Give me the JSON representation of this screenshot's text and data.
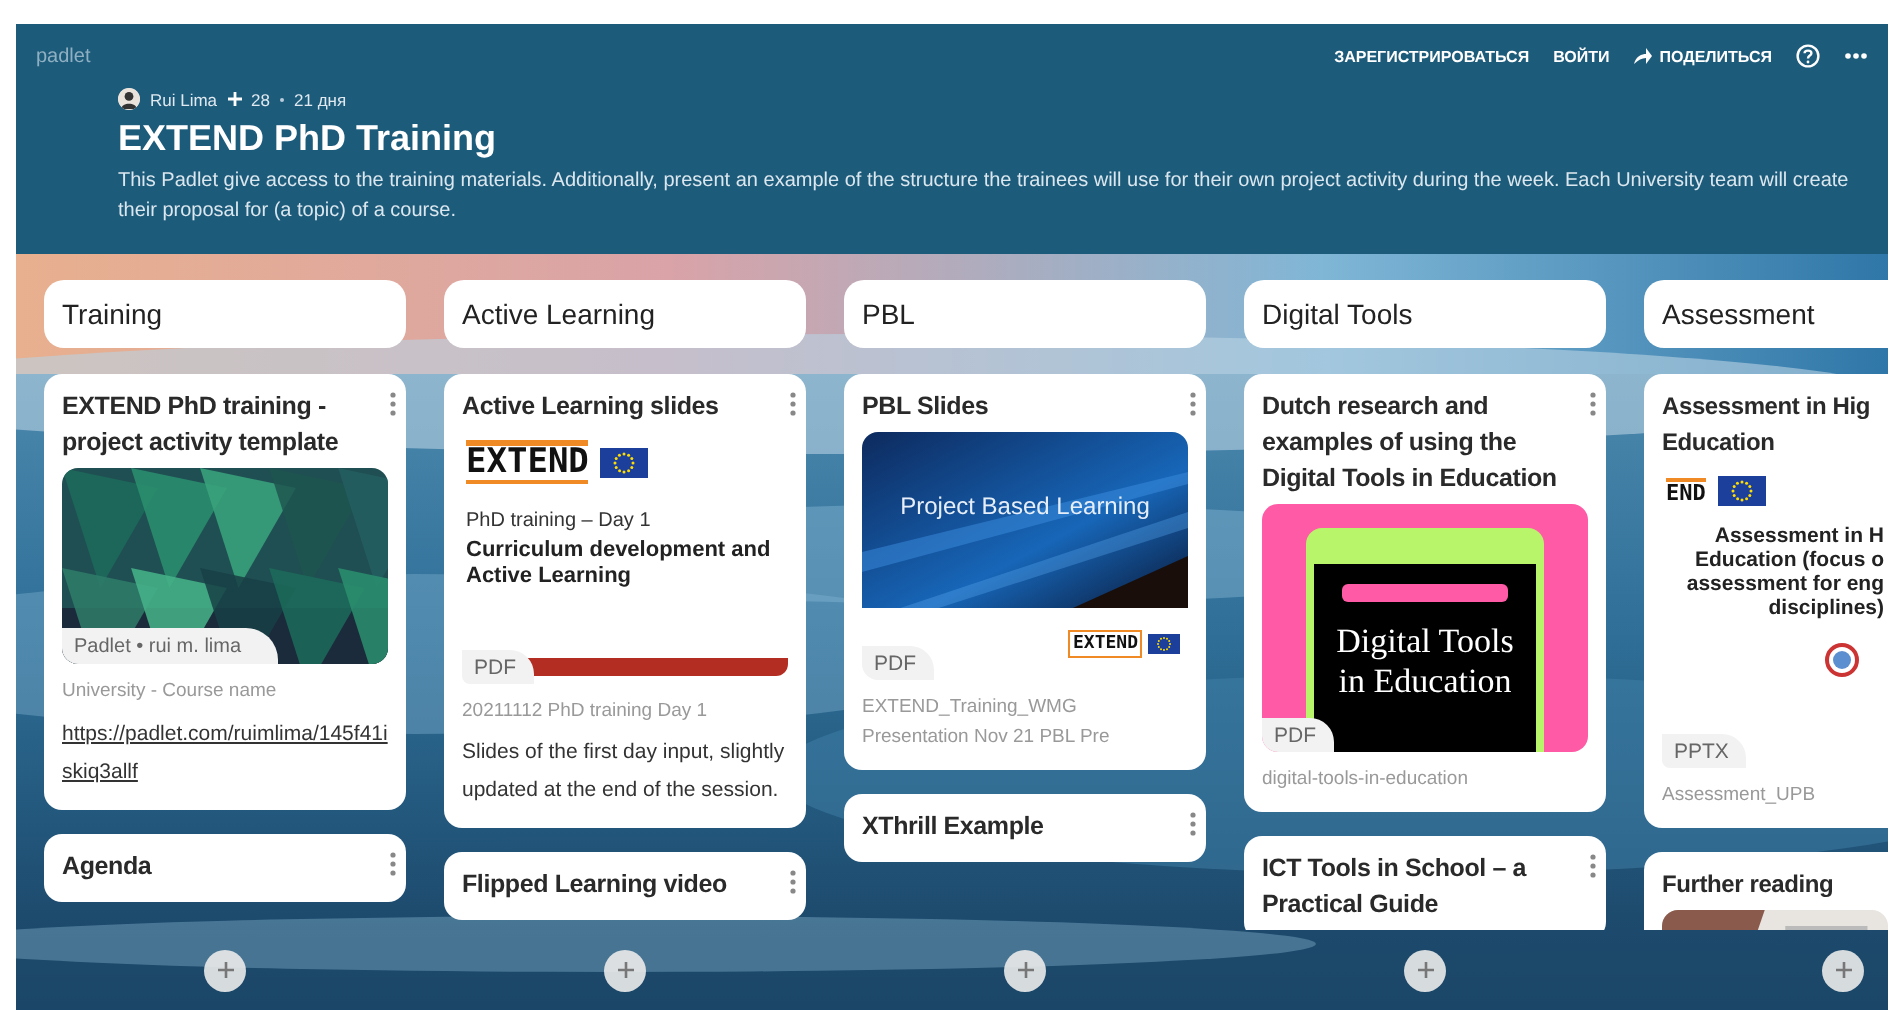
{
  "header": {
    "logo": "padlet",
    "actions": [
      {
        "kind": "text",
        "label": "ЗАРЕГИСТРИРОВАТЬСЯ"
      },
      {
        "kind": "text",
        "label": "ВОЙТИ"
      },
      {
        "kind": "share",
        "label": "ПОДЕЛИТЬСЯ"
      },
      {
        "kind": "help"
      },
      {
        "kind": "more"
      }
    ],
    "author": "Rui Lima",
    "likes": "28",
    "age": "21 дня",
    "title": "EXTEND PhD Training",
    "description": "This Padlet give access to the training materials. Additionally, present an example of the structure the trainees will use for their own project activity during the week. Each University team will create their proposal for (a topic) of a course."
  },
  "columns": [
    {
      "title": "Training",
      "posts": [
        {
          "title": "EXTEND PhD training - project activity template",
          "attachment": {
            "kind": "picture",
            "source": "Padlet • rui m. lima"
          },
          "caption": "University - Course name",
          "link": "https://padlet.com/ruimlima/145f41iskiq3allf"
        },
        {
          "title": "Agenda"
        }
      ]
    },
    {
      "title": "Active Learning",
      "posts": [
        {
          "title": "Active Learning slides",
          "attachment": {
            "kind": "document",
            "badge": "PDF",
            "logo": "EXTEND",
            "subtitle": "PhD training – Day 1",
            "heading": "Curriculum development and Active Learning"
          },
          "caption": "20211112 PhD training Day 1",
          "body": "Slides of the first day input, slightly updated at the end of the session."
        },
        {
          "title": "Flipped Learning video"
        }
      ]
    },
    {
      "title": "PBL",
      "posts": [
        {
          "title": "PBL Slides",
          "attachment": {
            "kind": "slide",
            "badge": "PDF",
            "heading": "Project Based Learning",
            "logo": "EXTEND"
          },
          "caption": "EXTEND_Training_WMG Presentation Nov 21 PBL Pre"
        },
        {
          "title": "XThrill Example"
        }
      ]
    },
    {
      "title": "Digital Tools",
      "posts": [
        {
          "title": "Dutch research and examples of using the Digital Tools in Education",
          "attachment": {
            "kind": "book",
            "badge": "PDF",
            "heading": "Digital Tools in Education"
          },
          "caption": "digital-tools-in-education"
        },
        {
          "title": "ICT Tools in School – a Practical Guide"
        }
      ]
    },
    {
      "title": "Assessment",
      "posts": [
        {
          "title": "Assessment in Hig\nEducation",
          "attachment": {
            "kind": "document",
            "badge": "PPTX",
            "logo": "END",
            "heading": "Assessment in H\nEducation (focus o\nassessment for eng\ndisciplines)"
          },
          "caption": "Assessment_UPB"
        },
        {
          "title": "Further reading"
        }
      ]
    }
  ]
}
